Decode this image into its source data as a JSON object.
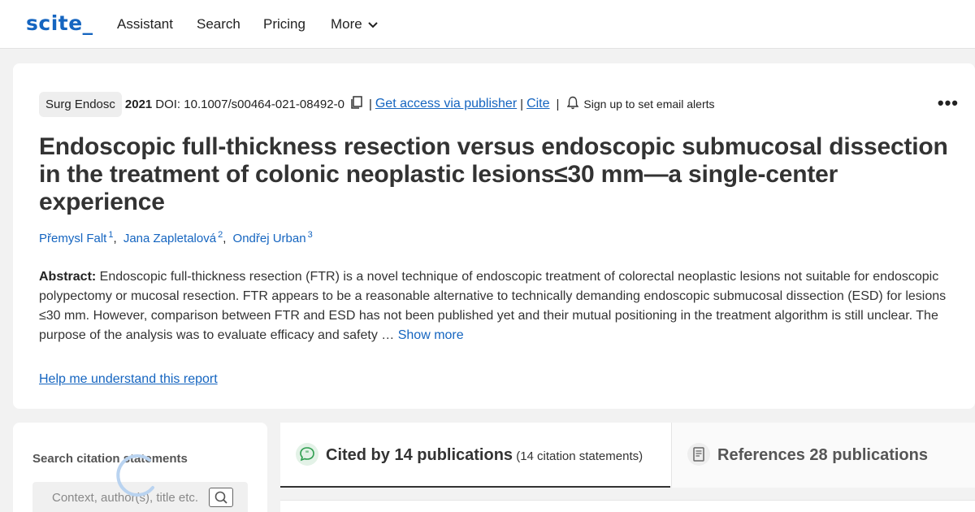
{
  "nav": {
    "logo": "scite_",
    "items": [
      "Assistant",
      "Search",
      "Pricing",
      "More"
    ]
  },
  "article": {
    "journal": "Surg Endosc",
    "year": "2021",
    "doi": "DOI: 10.1007/s00464-021-08492-0",
    "separator": "|",
    "access_link": "Get access via publisher",
    "cite_link": "Cite",
    "alerts": "Sign up to set email alerts",
    "title": "Endoscopic full-thickness resection versus endoscopic submucosal dissection in the treatment of colonic neoplastic lesions≤30 mm—a single-center experience",
    "authors": [
      {
        "name": "Přemysl Falt",
        "sup": "1"
      },
      {
        "name": "Jana Zapletalová",
        "sup": "2"
      },
      {
        "name": "Ondřej Urban",
        "sup": "3"
      }
    ],
    "abstract_label": "Abstract:",
    "abstract_text": " Endoscopic full-thickness resection (FTR) is a novel technique of endoscopic treatment of colorectal neoplastic lesions not suitable for endoscopic polypectomy or mucosal resection. FTR appears to be a reasonable alternative to technically demanding endoscopic submucosal dissection (ESD) for lesions ≤30 mm. However, comparison between FTR and ESD has not been published yet and their mutual positioning in the treatment algorithm is still unclear. The purpose of the analysis was to evaluate efficacy and safety … ",
    "show_more": "Show more",
    "help_link": "Help me understand this report"
  },
  "sidebar": {
    "title": "Search citation statements",
    "placeholder": "Context, author(s), title etc."
  },
  "tabs": {
    "cited": {
      "label": "Cited by 14 publications",
      "sub": " (14 citation statements)"
    },
    "refs": {
      "label": "References 28 publications"
    }
  },
  "colors": {
    "accent": "#1565c0",
    "cited_icon": "#2e9e4f"
  },
  "icons": [
    "copy-icon",
    "bell-icon",
    "chevron-down-icon",
    "search-icon",
    "quote-bubble-icon",
    "document-icon",
    "more-dots-icon"
  ]
}
